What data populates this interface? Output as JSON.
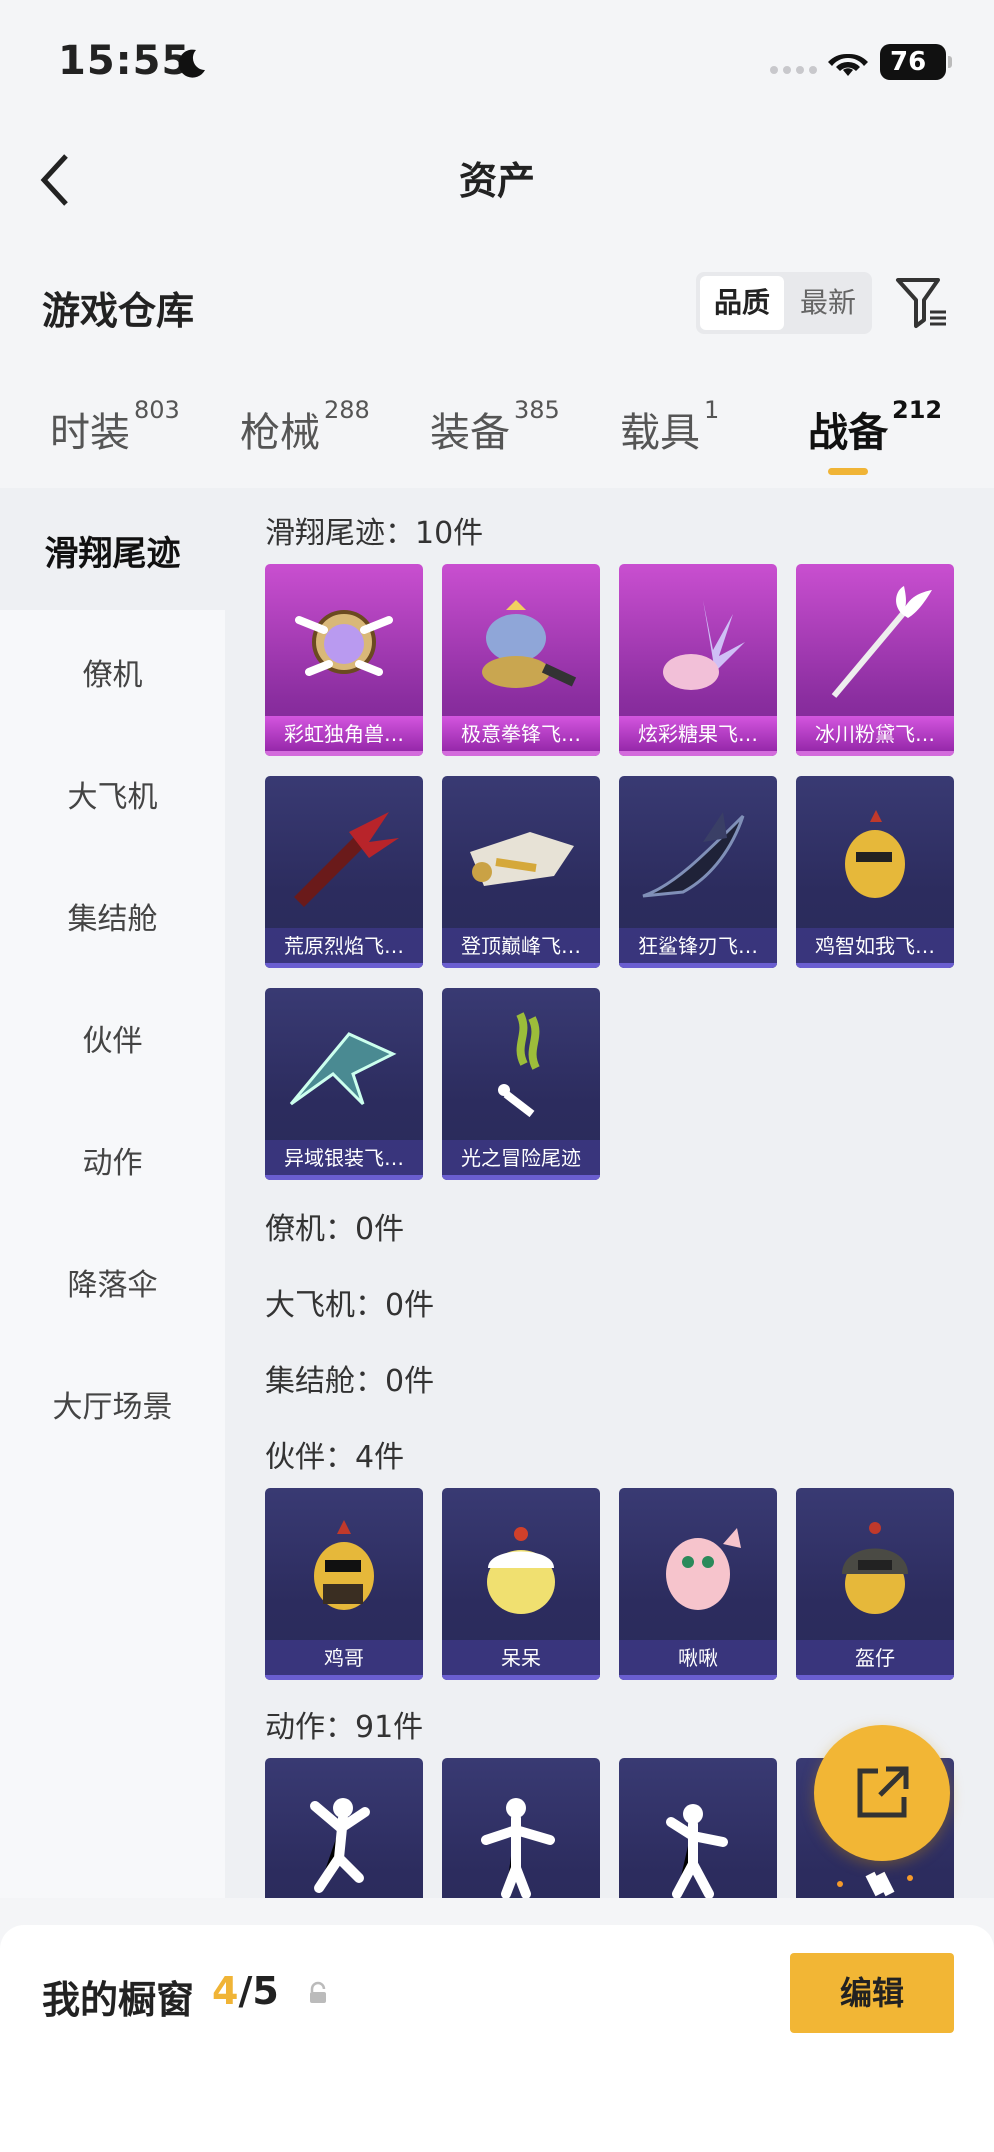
{
  "status_bar": {
    "time": "15:55",
    "battery": "76"
  },
  "nav": {
    "title": "资产"
  },
  "warehouse": {
    "title": "游戏仓库",
    "sort_options": [
      "品质",
      "最新"
    ],
    "sort_selected": "品质"
  },
  "tabs": [
    {
      "label": "时装",
      "count": "803"
    },
    {
      "label": "枪械",
      "count": "288"
    },
    {
      "label": "装备",
      "count": "385"
    },
    {
      "label": "载具",
      "count": "1"
    },
    {
      "label": "战备",
      "count": "212",
      "active": true
    }
  ],
  "sidebar": [
    "滑翔尾迹",
    "僚机",
    "大飞机",
    "集结舱",
    "伙伴",
    "动作",
    "降落伞",
    "大厅场景"
  ],
  "sections": {
    "trail": {
      "title": "滑翔尾迹：10件",
      "items": [
        "彩虹独角兽…",
        "极意拳锋飞…",
        "炫彩糖果飞…",
        "冰川粉黛飞…",
        "荒原烈焰飞…",
        "登顶巅峰飞…",
        "狂鲨锋刃飞…",
        "鸡智如我飞…",
        "异域银装飞…",
        "光之冒险尾迹"
      ]
    },
    "wingman": {
      "title": "僚机：0件"
    },
    "plane": {
      "title": "大飞机：0件"
    },
    "pod": {
      "title": "集结舱：0件"
    },
    "partner": {
      "title": "伙伴：4件",
      "items": [
        "鸡哥",
        "呆呆",
        "啾啾",
        "盔仔"
      ]
    },
    "emote": {
      "title": "动作：91件"
    }
  },
  "showcase": {
    "label": "我的橱窗",
    "current": "4",
    "total": "/5",
    "edit": "编辑"
  },
  "colors": {
    "accent": "#f2b635",
    "purple_card": "#b240c0",
    "blue_card": "#2f2f63"
  }
}
